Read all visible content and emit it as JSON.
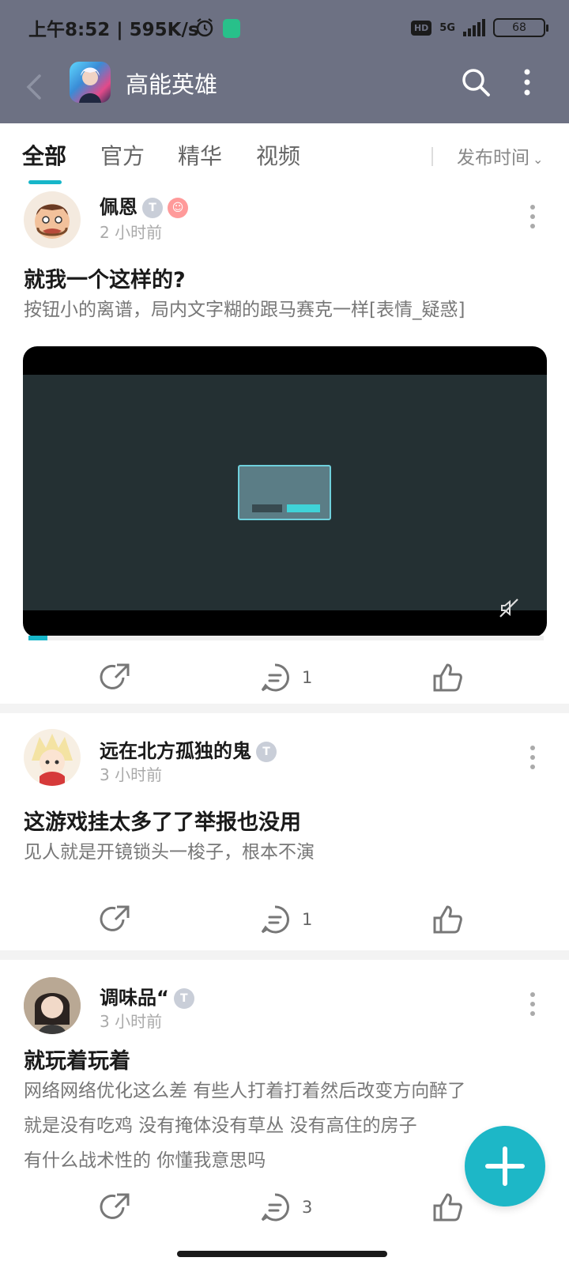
{
  "status_bar": {
    "time": "上午8:52 | 595K/s",
    "hd": "HD",
    "network": "5G",
    "battery": "68"
  },
  "header": {
    "title": "高能英雄",
    "back_icon": "back-arrow-icon",
    "search_icon": "search-icon",
    "more_icon": "more-vertical-icon",
    "colors": {
      "bar": "#6d7183"
    }
  },
  "tabs": {
    "items": [
      {
        "label": "全部",
        "active": true
      },
      {
        "label": "官方",
        "active": false
      },
      {
        "label": "精华",
        "active": false
      },
      {
        "label": "视频",
        "active": false
      }
    ],
    "sort_label": "发布时间",
    "accent": "#17b6c9"
  },
  "posts": [
    {
      "user": "佩恩",
      "time": "2 小时前",
      "title": "就我一个这样的?",
      "body": "按钮小的离谱，局内文字糊的跟马赛克一样[表情_疑惑]",
      "has_video": true,
      "comments": "1"
    },
    {
      "user": "远在北方孤独的鬼",
      "time": "3 小时前",
      "title": "这游戏挂太多了了举报也没用",
      "body": "见人就是开镜锁头一梭子，根本不演",
      "has_video": false,
      "comments": "1"
    },
    {
      "user": "调味品“",
      "time": "3 小时前",
      "title": "就玩着玩着",
      "body_lines": [
        "网络网络优化这么差 有些人打着打着然后改变方向醉了",
        "就是没有吃鸡 没有掩体没有草丛 没有高住的房子",
        "有什么战术性的 你懂我意思吗"
      ],
      "has_video": false,
      "comments": "3"
    }
  ],
  "fab_icon": "plus-icon"
}
